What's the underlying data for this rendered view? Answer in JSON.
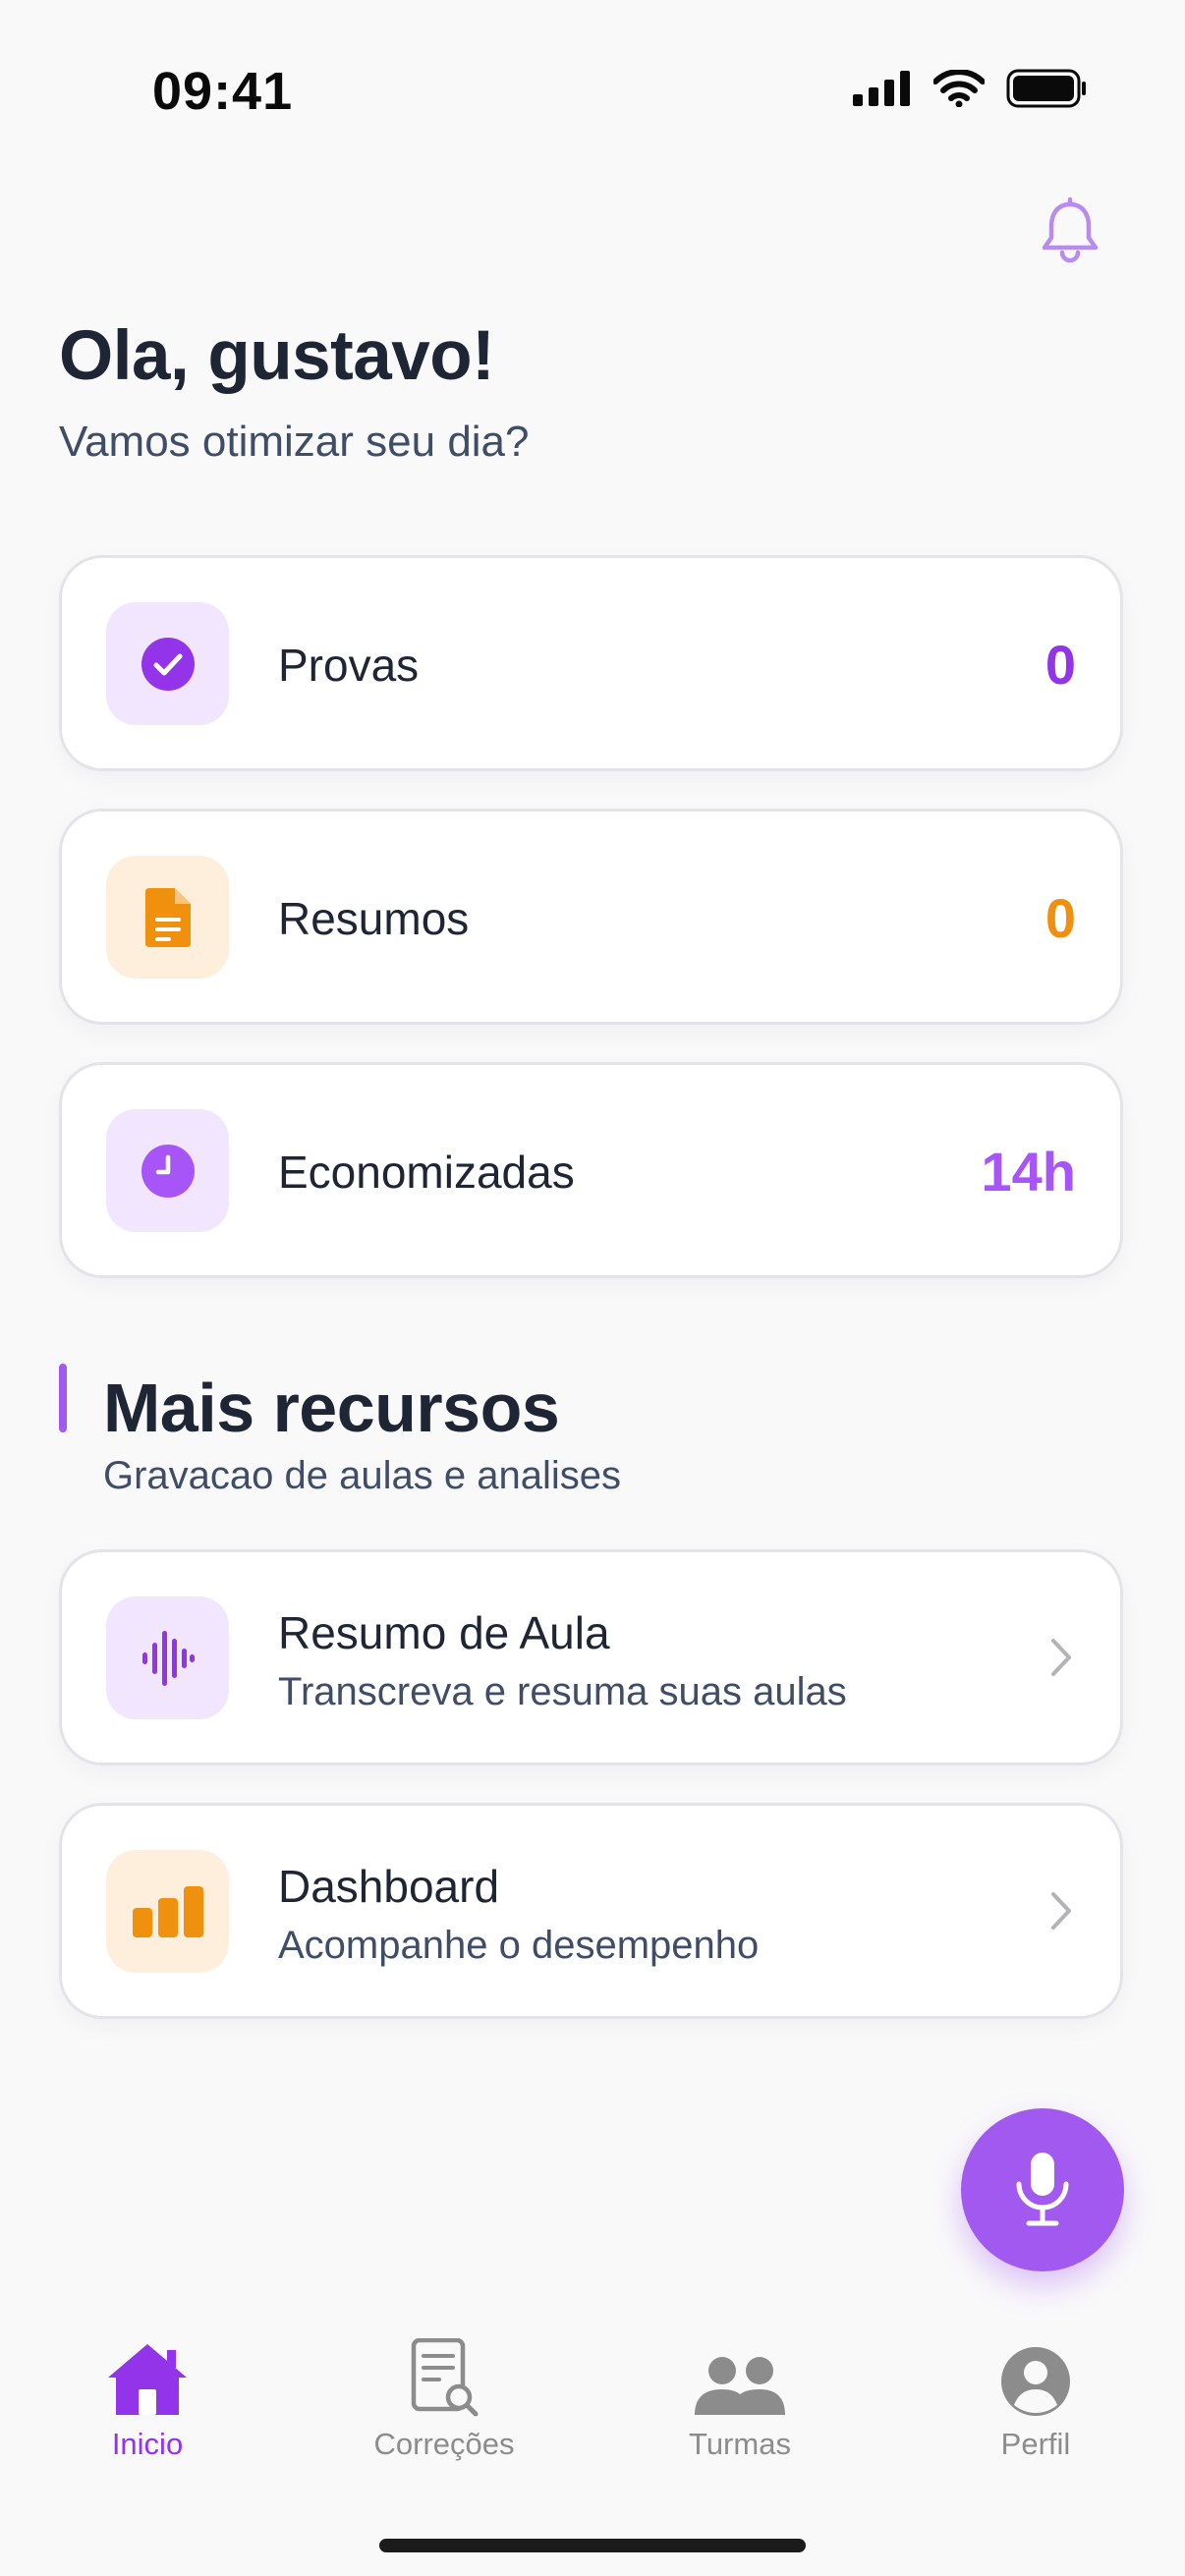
{
  "status_bar": {
    "time": "09:41"
  },
  "header": {
    "notification_icon": "bell-icon"
  },
  "greeting": {
    "title": "Ola, gustavo!",
    "subtitle": "Vamos otimizar seu dia?"
  },
  "stats": [
    {
      "label": "Provas",
      "value": "0",
      "icon": "check-circle-icon",
      "color": "#9333ea"
    },
    {
      "label": "Resumos",
      "value": "0",
      "icon": "document-icon",
      "color": "#f0900f"
    },
    {
      "label": "Economizadas",
      "value": "14h",
      "icon": "clock-icon",
      "color": "#a855f7"
    }
  ],
  "more": {
    "title": "Mais recursos",
    "subtitle": "Gravacao de aulas e analises",
    "items": [
      {
        "title": "Resumo de Aula",
        "desc": "Transcreva e resuma suas aulas",
        "icon": "waveform-icon"
      },
      {
        "title": "Dashboard",
        "desc": "Acompanhe o desempenho",
        "icon": "bar-chart-icon"
      }
    ]
  },
  "fab": {
    "icon": "microphone-icon"
  },
  "tabs": [
    {
      "label": "Inicio",
      "icon": "home-icon",
      "active": true
    },
    {
      "label": "Correções",
      "icon": "document-search-icon"
    },
    {
      "label": "Turmas",
      "icon": "people-icon"
    },
    {
      "label": "Perfil",
      "icon": "profile-icon"
    }
  ],
  "colors": {
    "accent": "#a259f0",
    "accent_dark": "#9333ea",
    "orange": "#f0900f",
    "background": "#f9f9fa"
  }
}
